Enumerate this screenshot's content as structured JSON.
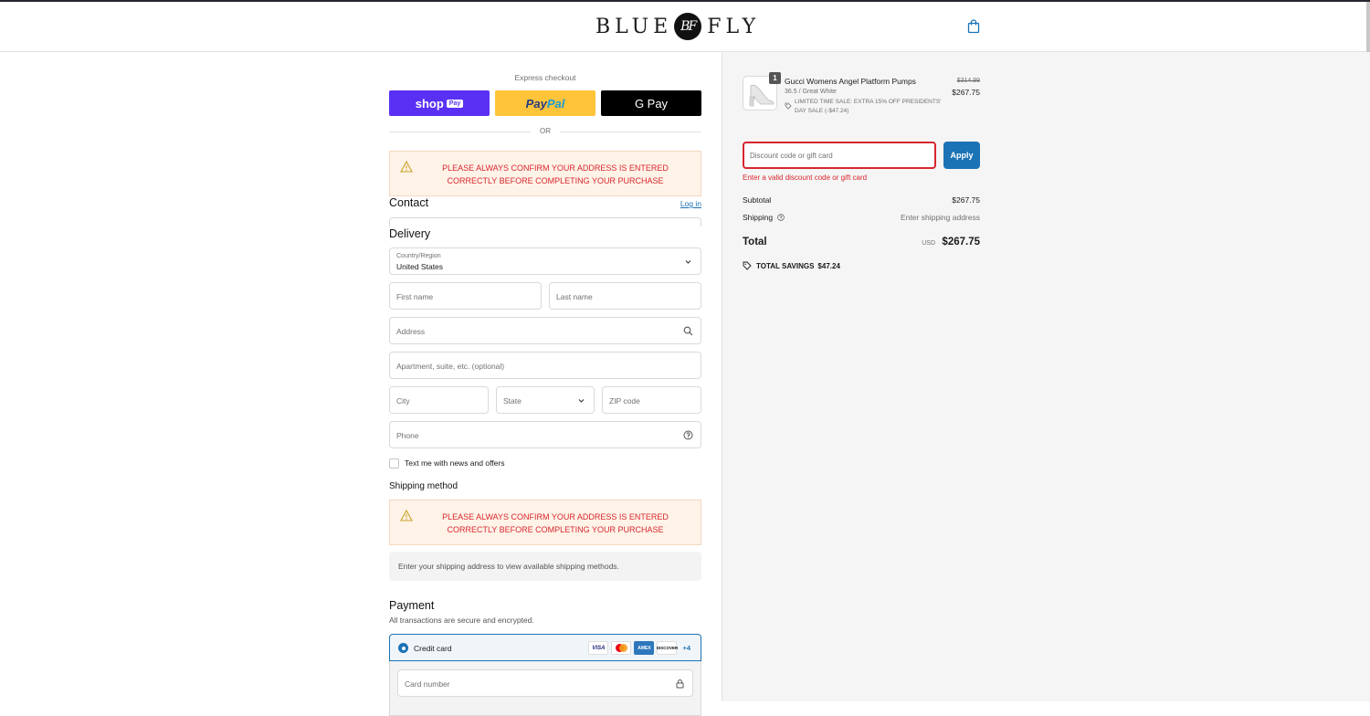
{
  "header": {
    "logo_left": "BLUE",
    "logo_monogram": "BF",
    "logo_right": "FLY"
  },
  "express": {
    "title": "Express checkout",
    "shop_pay": "shop",
    "shop_pay_badge": "Pay",
    "paypal_a": "Pay",
    "paypal_b": "Pal",
    "gpay": "G Pay",
    "or_text": "OR"
  },
  "warning_text": "PLEASE ALWAYS CONFIRM YOUR ADDRESS IS ENTERED CORRECTLY BEFORE COMPLETING YOUR PURCHASE",
  "contact": {
    "title": "Contact",
    "login": "Log in"
  },
  "delivery": {
    "title": "Delivery",
    "country_label": "Country/Region",
    "country_value": "United States",
    "first_name": "First name",
    "last_name": "Last name",
    "address": "Address",
    "apartment": "Apartment, suite, etc. (optional)",
    "city": "City",
    "state": "State",
    "zip": "ZIP code",
    "phone": "Phone",
    "news_checkbox": "Text me with news and offers"
  },
  "shipping_method": {
    "title": "Shipping method",
    "info": "Enter your shipping address to view available shipping methods."
  },
  "payment": {
    "title": "Payment",
    "subtitle": "All transactions are secure and encrypted.",
    "credit_card": "Credit card",
    "card_brands": [
      "VISA",
      "",
      "AMEX",
      "DISCOVER"
    ],
    "more_cards": "+4",
    "card_number": "Card number"
  },
  "summary": {
    "product": {
      "quantity": "1",
      "name": "Gucci Womens Angel Platform Pumps",
      "variant": "36.5 / Great White",
      "discount": "LIMITED TIME SALE: EXTRA 15% OFF PRESIDENTS' DAY SALE (-$47.24)",
      "price_old": "$314.99",
      "price_new": "$267.75"
    },
    "discount_placeholder": "Discount code or gift card",
    "apply": "Apply",
    "error": "Enter a valid discount code or gift card",
    "subtotal_label": "Subtotal",
    "subtotal_value": "$267.75",
    "shipping_label": "Shipping",
    "shipping_value": "Enter shipping address",
    "total_label": "Total",
    "total_currency": "USD",
    "total_value": "$267.75",
    "savings_label": "TOTAL SAVINGS",
    "savings_value": "$47.24"
  },
  "colors": {
    "accent": "#1a73b5",
    "error": "#d8262e",
    "warning_bg": "#fff3e8",
    "shop_pay": "#5a31f4",
    "paypal": "#ffc439"
  }
}
